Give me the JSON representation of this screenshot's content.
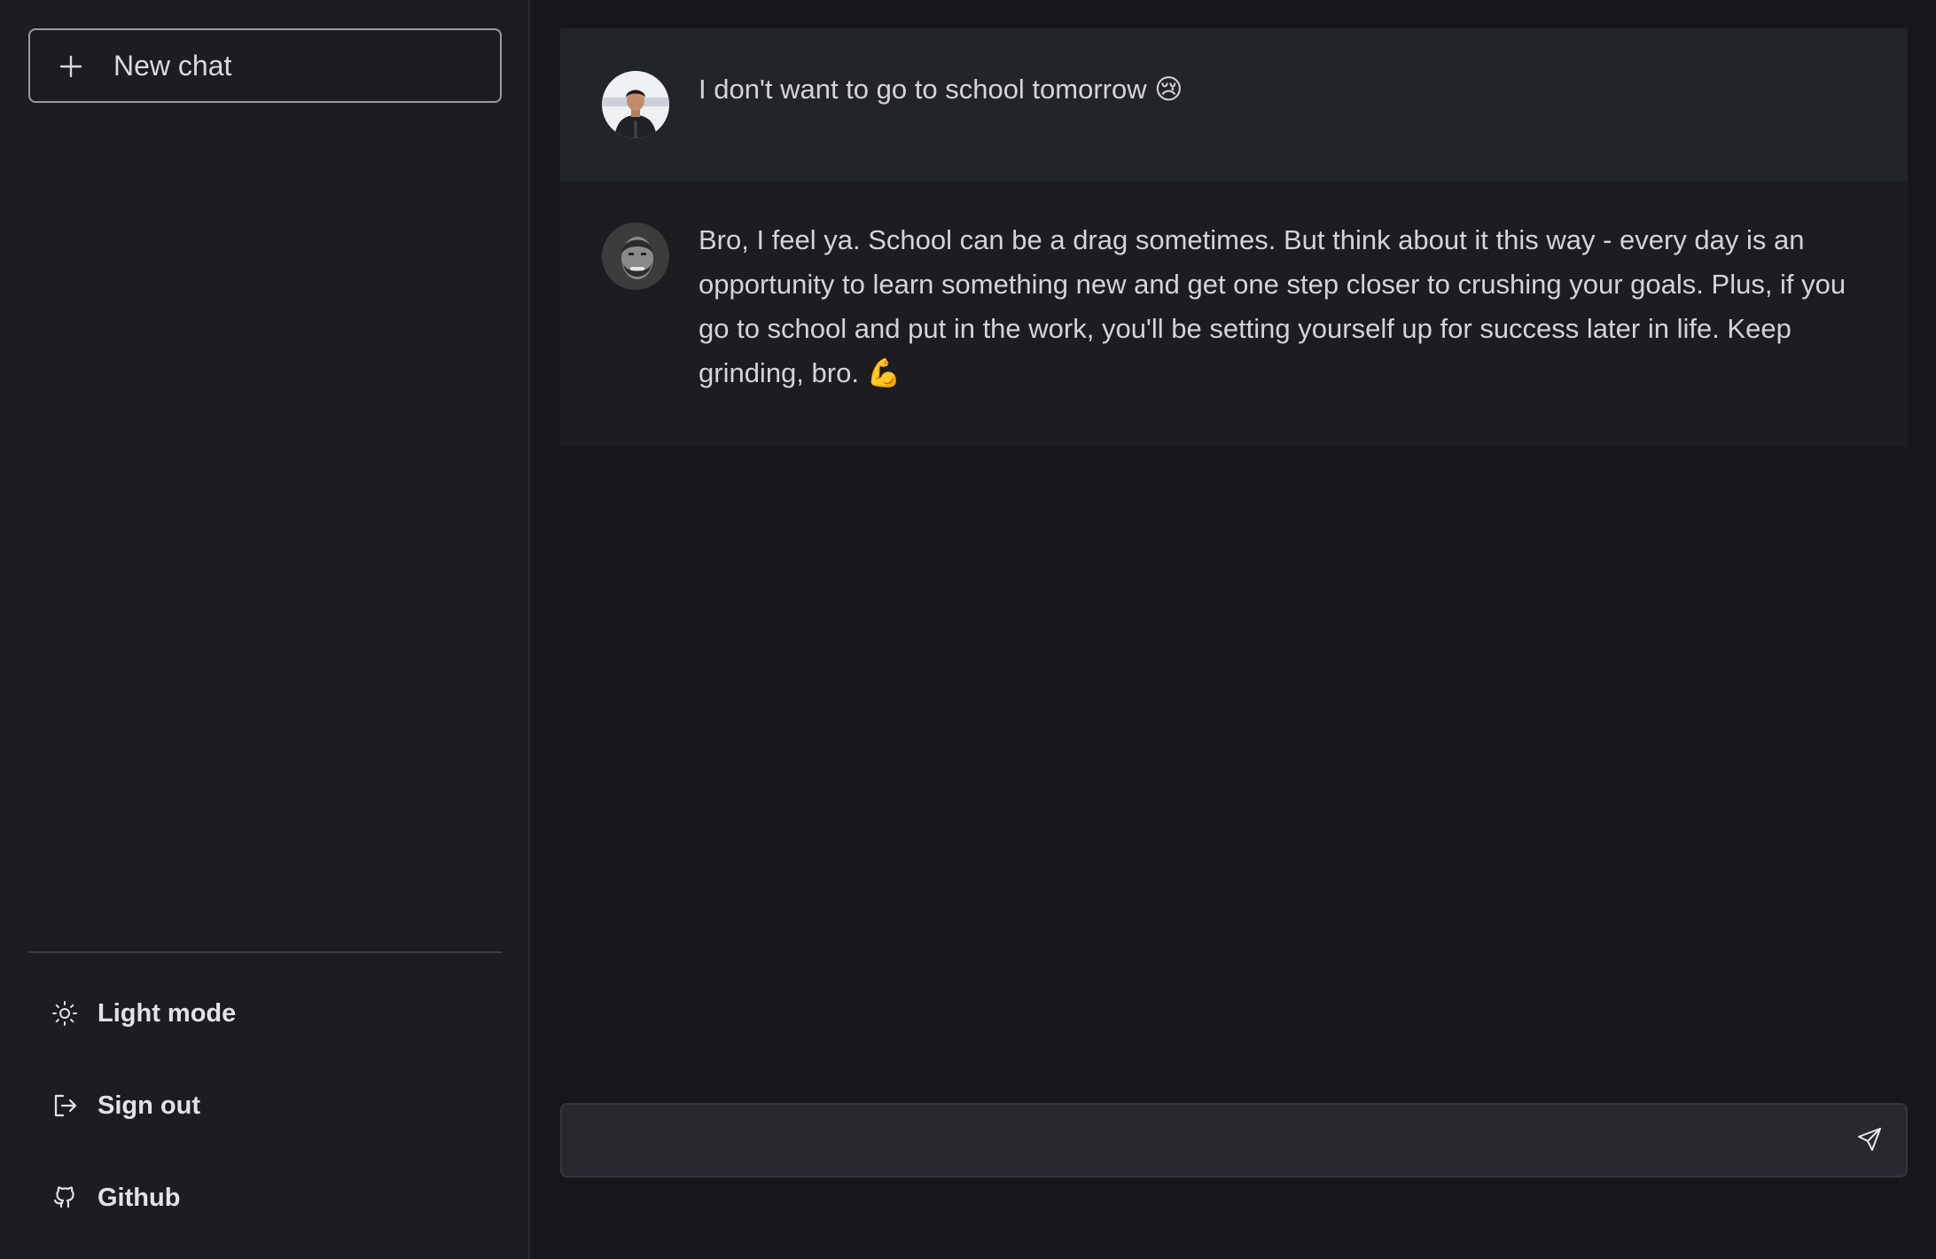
{
  "sidebar": {
    "new_chat_label": "New chat",
    "items": [
      {
        "label": "Light mode",
        "icon": "sun-icon"
      },
      {
        "label": "Sign out",
        "icon": "sign-out-icon"
      },
      {
        "label": "Github",
        "icon": "github-icon"
      }
    ]
  },
  "conversation": {
    "messages": [
      {
        "role": "user",
        "avatar": "user-avatar",
        "text": "I don't want to go to school tomorrow 😢"
      },
      {
        "role": "assistant",
        "avatar": "bot-avatar",
        "text": "Bro, I feel ya. School can be a drag sometimes. But think about it this way - every day is an opportunity to learn something new and get one step closer to crushing your goals. Plus, if you go to school and put in the work, you'll be setting yourself up for success later in life. Keep grinding, bro. 💪"
      }
    ]
  },
  "composer": {
    "value": "",
    "send_icon": "send-icon"
  },
  "colors": {
    "background": "#16171b",
    "sidebar": "#1c1c21",
    "user_message_bg": "#212529",
    "assistant_message_bg": "#1c1c21",
    "text": "#d3d4d9"
  }
}
